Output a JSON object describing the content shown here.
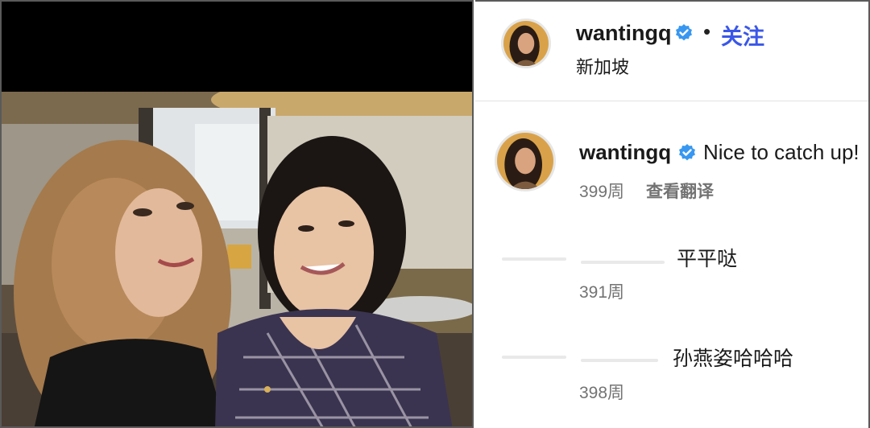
{
  "post": {
    "username": "wantingq",
    "follow_label": "关注",
    "location": "新加坡",
    "separator": "•"
  },
  "caption": {
    "username": "wantingq",
    "text": "Nice to catch up!",
    "time": "399周",
    "translate_label": "查看翻译"
  },
  "replies": [
    {
      "text": "平平哒",
      "time": "391周"
    },
    {
      "text": "孙燕姿哈哈哈",
      "time": "398周"
    }
  ],
  "colors": {
    "follow": "#3a57e8",
    "verified": "#3897f0",
    "muted_text": "#737373"
  },
  "icons": {
    "verified": "verified-badge-icon"
  }
}
